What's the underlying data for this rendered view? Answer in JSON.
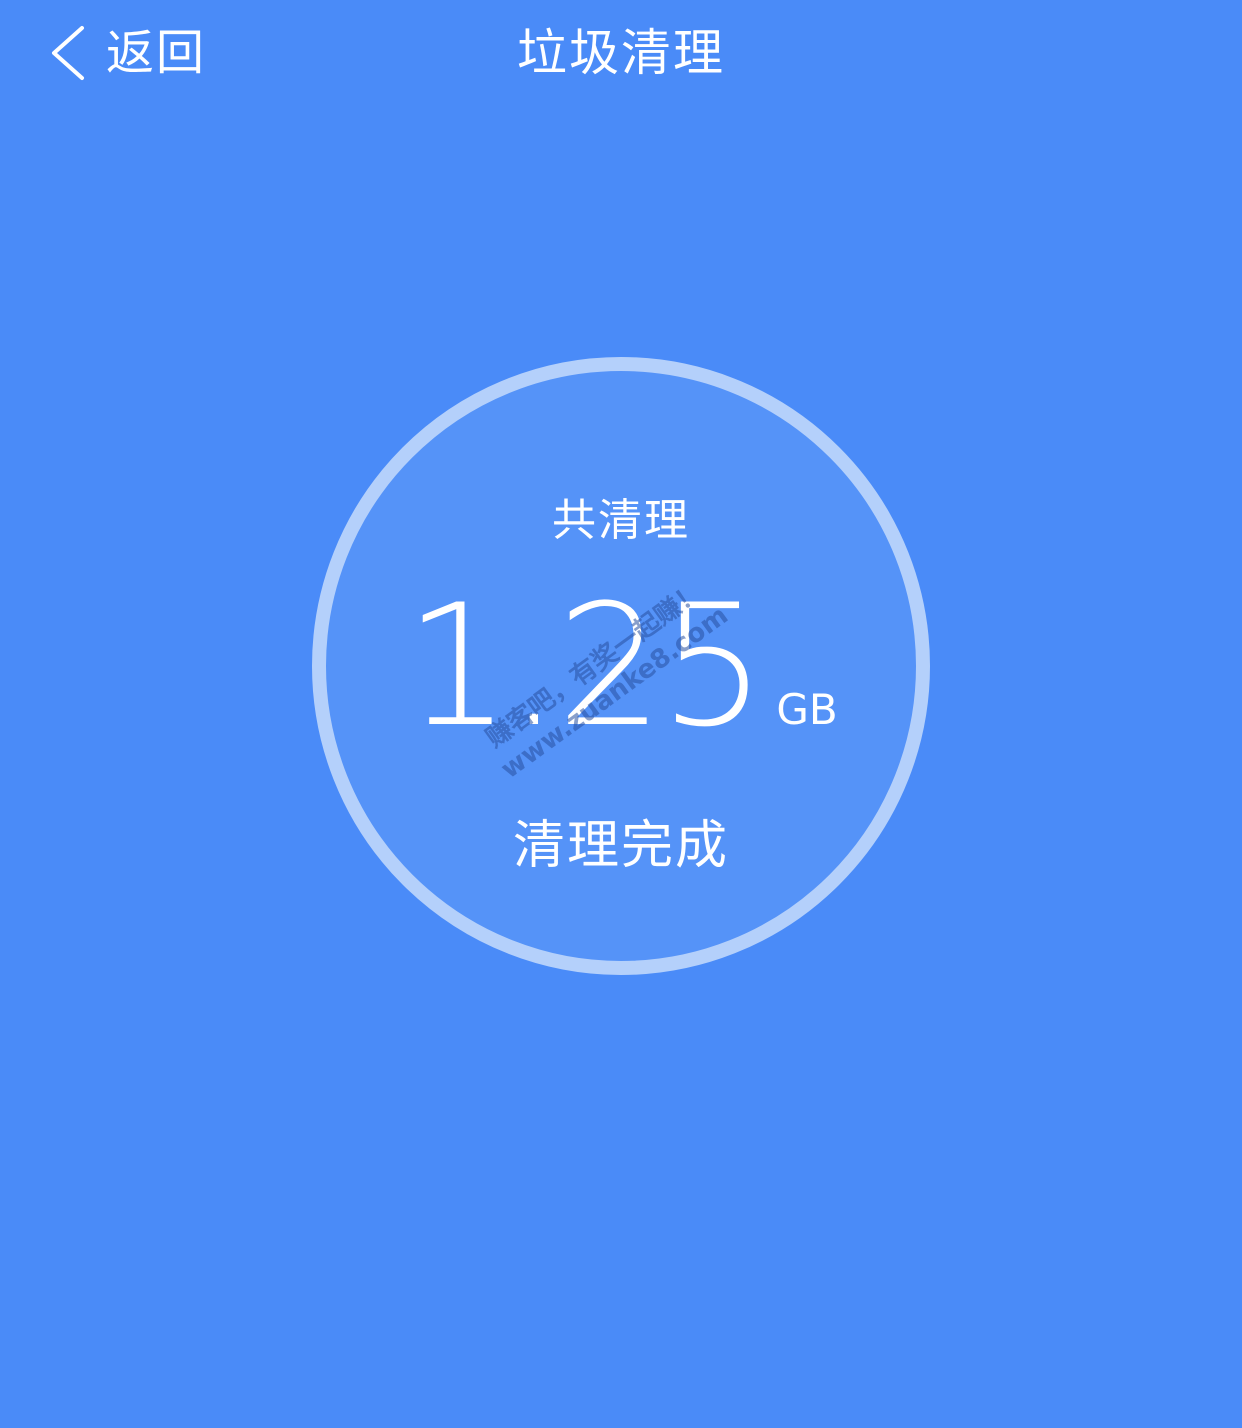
{
  "nav": {
    "back_label": "返回",
    "title": "垃圾清理"
  },
  "result": {
    "caption": "共清理",
    "size_value": "1.25",
    "size_unit": "GB",
    "status": "清理完成"
  },
  "watermark": {
    "line1": "赚客吧，有奖一起赚！",
    "line2": "www.zuanke8.com"
  },
  "colors": {
    "background": "#4a8bf8",
    "circle_fill": "#5593f8",
    "circle_ring": "#b4d0fb",
    "text": "#ffffff"
  },
  "icons": {
    "back": "chevron-left-icon"
  }
}
